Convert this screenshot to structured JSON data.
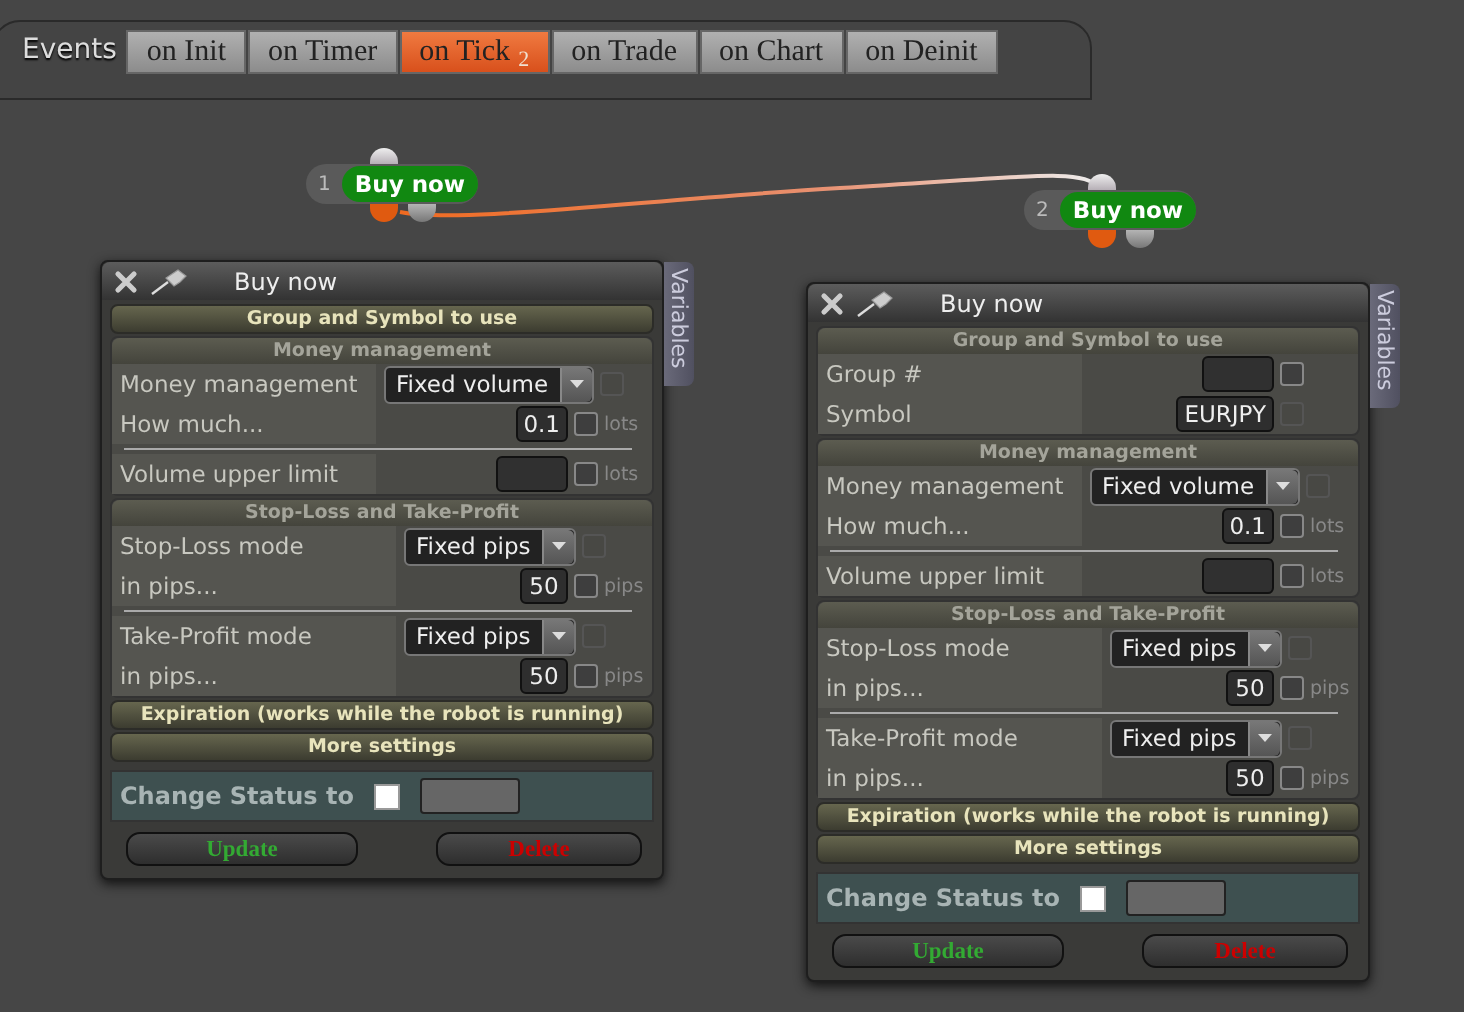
{
  "events_label": "Events",
  "tabs": [
    {
      "label": "on Init",
      "selected": false
    },
    {
      "label": "on Timer",
      "selected": false
    },
    {
      "label": "on Tick",
      "badge": "2",
      "selected": true
    },
    {
      "label": "on Trade",
      "selected": false
    },
    {
      "label": "on Chart",
      "selected": false
    },
    {
      "label": "on Deinit",
      "selected": false
    }
  ],
  "nodes": [
    {
      "number": "1",
      "label": "Buy now"
    },
    {
      "number": "2",
      "label": "Buy now"
    }
  ],
  "panels": [
    {
      "title": "Buy now",
      "side_tab": "Variables",
      "sections": [
        {
          "title": "Group and Symbol to use",
          "expanded": false
        },
        {
          "title": "Money management",
          "expanded": true,
          "groups": [
            {
              "rows": [
                {
                  "label": "Money management",
                  "kind": "select",
                  "value": "Fixed volume",
                  "checkbox": {
                    "checked": false,
                    "disabled": true
                  }
                },
                {
                  "label": "How much...",
                  "kind": "input",
                  "value": "0.1",
                  "unit": "lots",
                  "checkbox": {
                    "checked": false,
                    "disabled": false
                  }
                }
              ]
            },
            {
              "rows": [
                {
                  "label": "Volume upper limit",
                  "kind": "input",
                  "unit": "lots",
                  "checkbox": {
                    "checked": false,
                    "disabled": false
                  }
                }
              ]
            }
          ]
        },
        {
          "title": "Stop-Loss and Take-Profit",
          "expanded": true,
          "groups": [
            {
              "rows": [
                {
                  "label": "Stop-Loss mode",
                  "kind": "select",
                  "value": "Fixed pips",
                  "checkbox": {
                    "checked": false,
                    "disabled": true
                  }
                },
                {
                  "label": "in pips...",
                  "kind": "input",
                  "value": "50",
                  "unit": "pips",
                  "checkbox": {
                    "checked": false,
                    "disabled": false
                  }
                }
              ]
            },
            {
              "rows": [
                {
                  "label": "Take-Profit mode",
                  "kind": "select",
                  "value": "Fixed pips",
                  "checkbox": {
                    "checked": false,
                    "disabled": true
                  }
                },
                {
                  "label": "in pips...",
                  "kind": "input",
                  "value": "50",
                  "unit": "pips",
                  "checkbox": {
                    "checked": false,
                    "disabled": false
                  }
                }
              ]
            }
          ]
        },
        {
          "title": "Expiration (works while the robot is running)",
          "expanded": false
        },
        {
          "title": "More settings",
          "expanded": false
        }
      ],
      "status": {
        "label": "Change Status to",
        "checked": false
      },
      "buttons": [
        {
          "label": "Update",
          "kind": "update"
        },
        {
          "label": "Delete",
          "kind": "delete"
        }
      ]
    },
    {
      "title": "Buy now",
      "side_tab": "Variables",
      "sections": [
        {
          "title": "Group and Symbol to use",
          "expanded": true,
          "groups": [
            {
              "rows": [
                {
                  "label": "Group #",
                  "kind": "input",
                  "checkbox": {
                    "checked": false,
                    "disabled": false
                  }
                },
                {
                  "label": "Symbol",
                  "kind": "input",
                  "value": "EURJPY",
                  "checkbox": {
                    "checked": false,
                    "disabled": true
                  }
                }
              ]
            }
          ]
        },
        {
          "title": "Money management",
          "expanded": true,
          "groups": [
            {
              "rows": [
                {
                  "label": "Money management",
                  "kind": "select",
                  "value": "Fixed volume",
                  "checkbox": {
                    "checked": false,
                    "disabled": true
                  }
                },
                {
                  "label": "How much...",
                  "kind": "input",
                  "value": "0.1",
                  "unit": "lots",
                  "checkbox": {
                    "checked": false,
                    "disabled": false
                  }
                }
              ]
            },
            {
              "rows": [
                {
                  "label": "Volume upper limit",
                  "kind": "input",
                  "unit": "lots",
                  "checkbox": {
                    "checked": false,
                    "disabled": false
                  }
                }
              ]
            }
          ]
        },
        {
          "title": "Stop-Loss and Take-Profit",
          "expanded": true,
          "groups": [
            {
              "rows": [
                {
                  "label": "Stop-Loss mode",
                  "kind": "select",
                  "value": "Fixed pips",
                  "checkbox": {
                    "checked": false,
                    "disabled": true
                  }
                },
                {
                  "label": "in pips...",
                  "kind": "input",
                  "value": "50",
                  "unit": "pips",
                  "checkbox": {
                    "checked": false,
                    "disabled": false
                  }
                }
              ]
            },
            {
              "rows": [
                {
                  "label": "Take-Profit mode",
                  "kind": "select",
                  "value": "Fixed pips",
                  "checkbox": {
                    "checked": false,
                    "disabled": true
                  }
                },
                {
                  "label": "in pips...",
                  "kind": "input",
                  "value": "50",
                  "unit": "pips",
                  "checkbox": {
                    "checked": false,
                    "disabled": false
                  }
                }
              ]
            }
          ]
        },
        {
          "title": "Expiration (works while the robot is running)",
          "expanded": false
        },
        {
          "title": "More settings",
          "expanded": false
        }
      ],
      "status": {
        "label": "Change Status to",
        "checked": false
      },
      "buttons": [
        {
          "label": "Update",
          "kind": "update"
        },
        {
          "label": "Delete",
          "kind": "delete"
        }
      ]
    }
  ]
}
